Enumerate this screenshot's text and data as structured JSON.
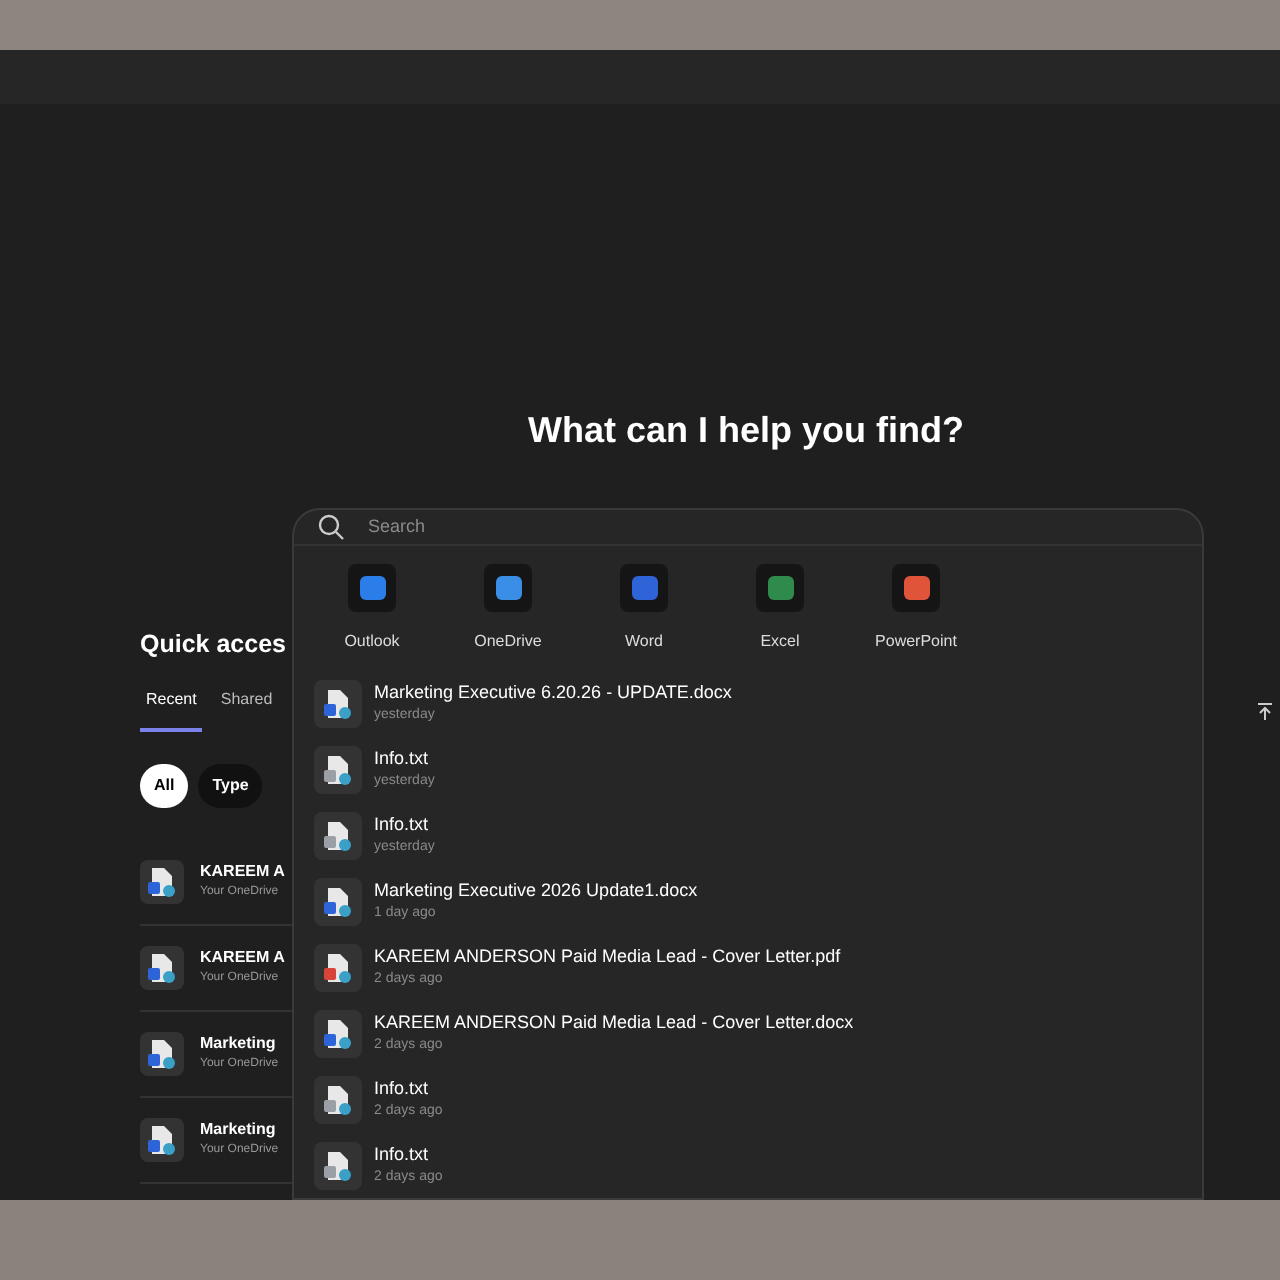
{
  "heading": "What can I help you find?",
  "quick_access": {
    "title": "Quick acces",
    "tabs": [
      {
        "label": "Recent",
        "selected": true
      },
      {
        "label": "Shared",
        "selected": false
      }
    ],
    "filters": [
      {
        "label": "All",
        "selected": true
      },
      {
        "label": "Type",
        "selected": false
      }
    ],
    "files": [
      {
        "name": "KAREEM A",
        "location": "Your OneDrive"
      },
      {
        "name": "KAREEM A",
        "location": "Your OneDrive"
      },
      {
        "name": "Marketing",
        "location": "Your OneDrive"
      },
      {
        "name": "Marketing",
        "location": "Your OneDrive"
      }
    ]
  },
  "search": {
    "placeholder": "Search",
    "apps": [
      {
        "label": "Outlook",
        "color": "#2b7de9"
      },
      {
        "label": "OneDrive",
        "color": "#3a8ee6"
      },
      {
        "label": "Word",
        "color": "#2f63d8"
      },
      {
        "label": "Excel",
        "color": "#2e8b4b"
      },
      {
        "label": "PowerPoint",
        "color": "#e0553a"
      }
    ],
    "results": [
      {
        "name": "Marketing Executive 6.20.26 - UPDATE.docx",
        "time": "yesterday",
        "kind": "word"
      },
      {
        "name": "Info.txt",
        "time": "yesterday",
        "kind": "text"
      },
      {
        "name": "Info.txt",
        "time": "yesterday",
        "kind": "text"
      },
      {
        "name": "Marketing Executive 2026 Update1.docx",
        "time": "1 day ago",
        "kind": "word"
      },
      {
        "name": "KAREEM ANDERSON Paid Media Lead - Cover Letter.pdf",
        "time": "2 days ago",
        "kind": "pdf"
      },
      {
        "name": "KAREEM ANDERSON Paid Media Lead - Cover Letter.docx",
        "time": "2 days ago",
        "kind": "word"
      },
      {
        "name": "Info.txt",
        "time": "2 days ago",
        "kind": "text"
      },
      {
        "name": "Info.txt",
        "time": "2 days ago",
        "kind": "text"
      }
    ]
  }
}
